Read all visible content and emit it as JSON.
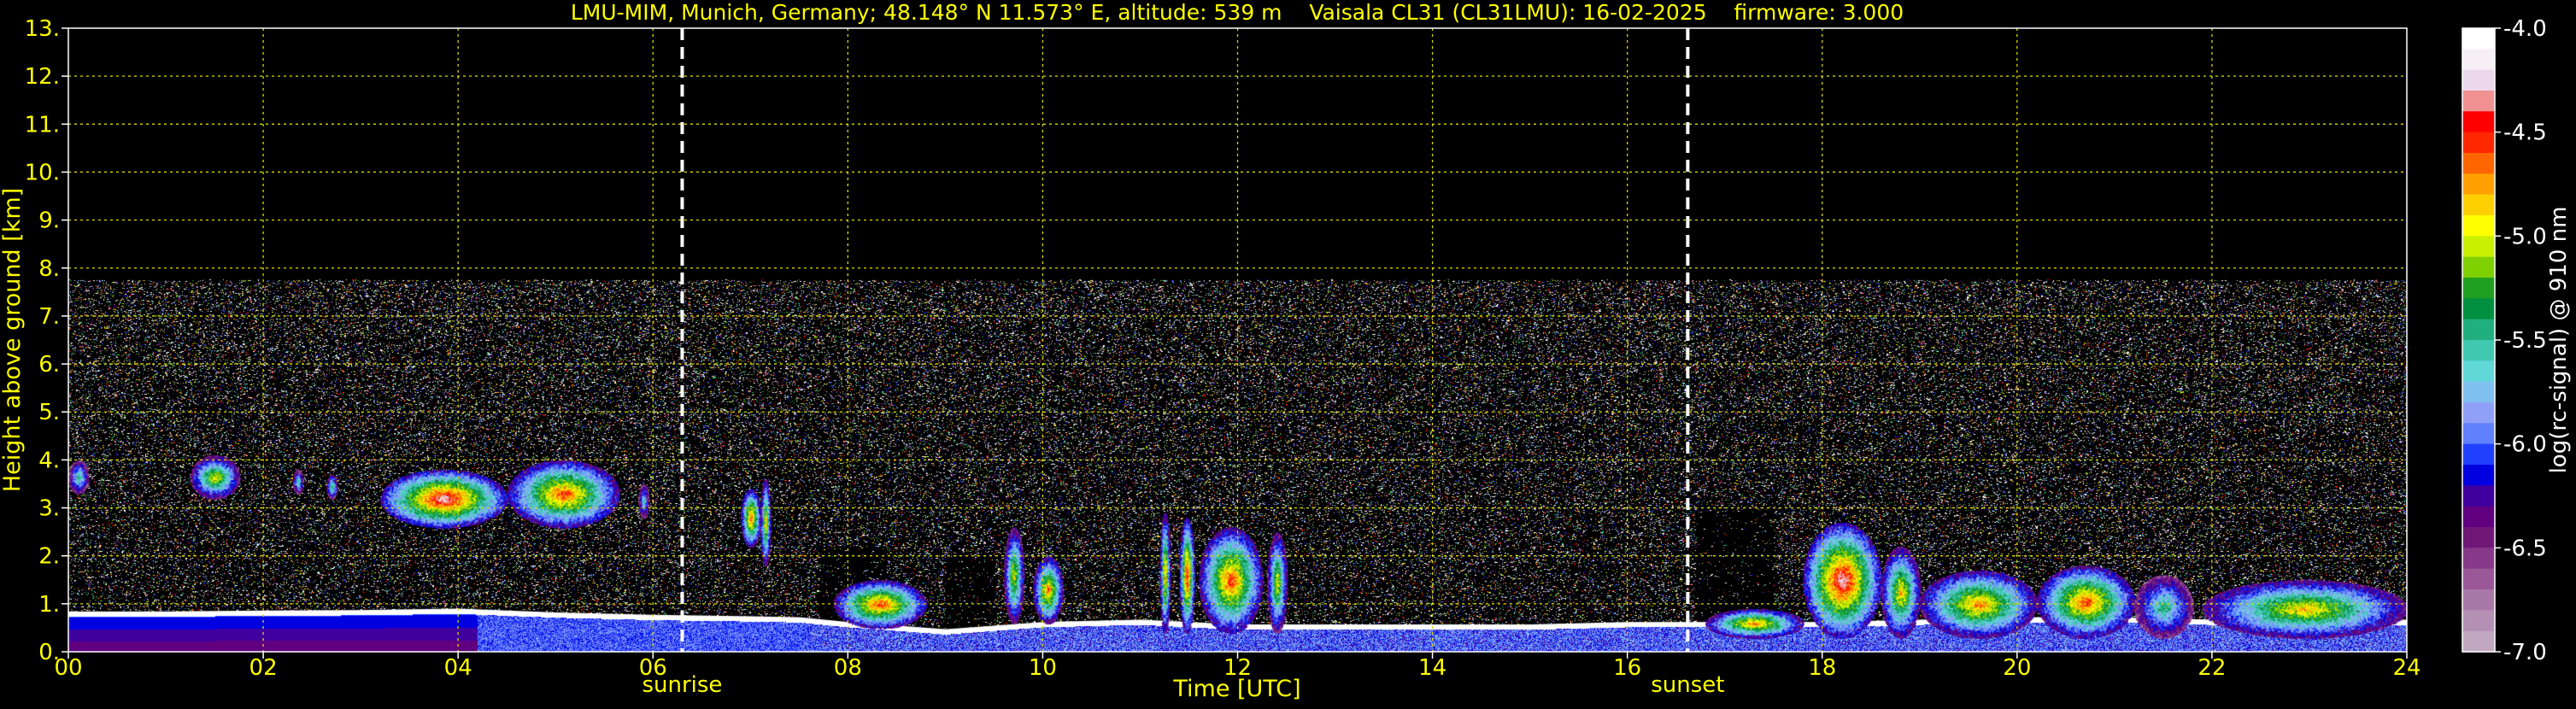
{
  "chart_data": {
    "type": "heatmap",
    "title": "LMU-MIM, Munich, Germany; 48.148° N 11.573° E, altitude: 539 m    Vaisala CL31 (CL31LMU): 16-02-2025    firmware: 3.000",
    "xlabel": "Time [UTC]",
    "ylabel": "Height above ground [km]",
    "xlim": [
      0,
      24
    ],
    "ylim": [
      0,
      13
    ],
    "xticks": [
      "00",
      "02",
      "04",
      "06",
      "08",
      "10",
      "12",
      "14",
      "16",
      "18",
      "20",
      "22",
      "24"
    ],
    "xtick_values": [
      0,
      2,
      4,
      6,
      8,
      10,
      12,
      14,
      16,
      18,
      20,
      22,
      24
    ],
    "yticks": [
      "0.",
      "1.",
      "2.",
      "3.",
      "4.",
      "5.",
      "6.",
      "7.",
      "8.",
      "9.",
      "10.",
      "11.",
      "12.",
      "13."
    ],
    "ytick_values": [
      0,
      1,
      2,
      3,
      4,
      5,
      6,
      7,
      8,
      9,
      10,
      11,
      12,
      13
    ],
    "grid": true,
    "markers": [
      {
        "label": "sunrise",
        "time": 6.3
      },
      {
        "label": "sunset",
        "time": 16.62
      }
    ],
    "colorbar": {
      "label": "log(rc-signal) @ 910 nm",
      "range": [
        -7.0,
        -4.0
      ],
      "ticks": [
        "-4.0",
        "-4.5",
        "-5.0",
        "-5.5",
        "-6.0",
        "-6.5",
        "-7.0"
      ],
      "tick_values": [
        -4.0,
        -4.5,
        -5.0,
        -5.5,
        -6.0,
        -6.5,
        -7.0
      ],
      "colors": [
        "#ffffff",
        "#f6f0f6",
        "#ecd8ec",
        "#f09090",
        "#ff0000",
        "#ff2800",
        "#ff6600",
        "#ffa000",
        "#ffd000",
        "#ffff00",
        "#c8f000",
        "#7fd000",
        "#20a020",
        "#009040",
        "#20b080",
        "#40c8b0",
        "#60d8d8",
        "#80c0f0",
        "#90a0f8",
        "#6080ff",
        "#2040ff",
        "#0000e0",
        "#4000a0",
        "#600080",
        "#701878",
        "#883888",
        "#9a5898",
        "#a878a8",
        "#b490b4",
        "#c0a8c0"
      ]
    },
    "noise_top_km": 7.75,
    "boundary_layer_km": [
      [
        0,
        0.72
      ],
      [
        1,
        0.72
      ],
      [
        2,
        0.74
      ],
      [
        3,
        0.75
      ],
      [
        4,
        0.78
      ],
      [
        5,
        0.7
      ],
      [
        6,
        0.65
      ],
      [
        7,
        0.62
      ],
      [
        7.5,
        0.6
      ],
      [
        8,
        0.5
      ],
      [
        9,
        0.35
      ],
      [
        10,
        0.5
      ],
      [
        11,
        0.55
      ],
      [
        12,
        0.45
      ],
      [
        13,
        0.45
      ],
      [
        14,
        0.45
      ],
      [
        15,
        0.45
      ],
      [
        16,
        0.5
      ],
      [
        16.6,
        0.5
      ],
      [
        17,
        0.5
      ],
      [
        18,
        0.5
      ],
      [
        19,
        0.55
      ],
      [
        20,
        0.6
      ],
      [
        21,
        0.6
      ],
      [
        22,
        0.55
      ],
      [
        23,
        0.55
      ],
      [
        24,
        0.55
      ]
    ],
    "cloud_features": [
      {
        "t0": 0.0,
        "t1": 0.2,
        "h0": 3.3,
        "h1": 4.0,
        "level": 0.55
      },
      {
        "t0": 1.25,
        "t1": 1.75,
        "h0": 3.2,
        "h1": 4.1,
        "level": 0.7
      },
      {
        "t0": 2.3,
        "t1": 2.4,
        "h0": 3.3,
        "h1": 3.8,
        "level": 0.55
      },
      {
        "t0": 2.65,
        "t1": 2.75,
        "h0": 3.2,
        "h1": 3.7,
        "level": 0.6
      },
      {
        "t0": 3.2,
        "t1": 4.5,
        "h0": 2.6,
        "h1": 3.8,
        "level": 0.95
      },
      {
        "t0": 4.5,
        "t1": 5.65,
        "h0": 2.6,
        "h1": 4.0,
        "level": 0.85
      },
      {
        "t0": 5.85,
        "t1": 5.95,
        "h0": 2.8,
        "h1": 3.5,
        "level": 0.5
      },
      {
        "t0": 6.9,
        "t1": 7.1,
        "h0": 2.2,
        "h1": 3.4,
        "level": 0.85
      },
      {
        "t0": 7.1,
        "t1": 7.2,
        "h0": 1.8,
        "h1": 3.6,
        "level": 0.75
      },
      {
        "t0": 7.85,
        "t1": 8.8,
        "h0": 0.5,
        "h1": 1.5,
        "level": 0.85
      },
      {
        "t0": 9.6,
        "t1": 9.8,
        "h0": 0.6,
        "h1": 2.6,
        "level": 0.7
      },
      {
        "t0": 9.9,
        "t1": 10.2,
        "h0": 0.6,
        "h1": 2.0,
        "level": 0.8
      },
      {
        "t0": 11.2,
        "t1": 11.3,
        "h0": 0.4,
        "h1": 2.9,
        "level": 0.8
      },
      {
        "t0": 11.4,
        "t1": 11.55,
        "h0": 0.4,
        "h1": 2.8,
        "level": 0.9
      },
      {
        "t0": 11.6,
        "t1": 12.25,
        "h0": 0.4,
        "h1": 2.6,
        "level": 0.85
      },
      {
        "t0": 12.3,
        "t1": 12.5,
        "h0": 0.4,
        "h1": 2.5,
        "level": 0.7
      },
      {
        "t0": 16.8,
        "t1": 17.8,
        "h0": 0.3,
        "h1": 0.9,
        "level": 0.8
      },
      {
        "t0": 17.8,
        "t1": 18.6,
        "h0": 0.3,
        "h1": 2.7,
        "level": 0.95
      },
      {
        "t0": 18.6,
        "t1": 19.0,
        "h0": 0.3,
        "h1": 2.2,
        "level": 0.75
      },
      {
        "t0": 19.0,
        "t1": 20.2,
        "h0": 0.3,
        "h1": 1.7,
        "level": 0.8
      },
      {
        "t0": 20.2,
        "t1": 21.2,
        "h0": 0.3,
        "h1": 1.8,
        "level": 0.85
      },
      {
        "t0": 21.2,
        "t1": 21.8,
        "h0": 0.3,
        "h1": 1.6,
        "level": 0.55
      },
      {
        "t0": 21.9,
        "t1": 24.0,
        "h0": 0.3,
        "h1": 1.5,
        "level": 0.75
      }
    ]
  }
}
